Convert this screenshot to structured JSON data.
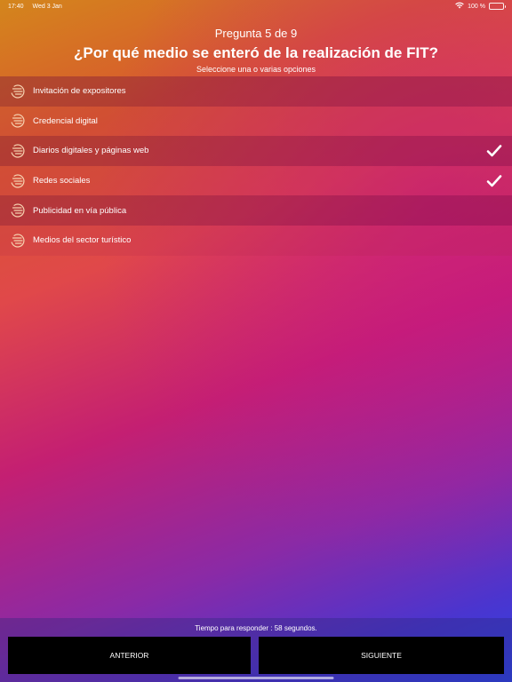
{
  "status_bar": {
    "time": "17:40",
    "date": "Wed 3 Jan",
    "battery": "100 %",
    "wifi_icon": "wifi-icon",
    "battery_icon": "battery-icon"
  },
  "question": {
    "counter": "Pregunta 5 de 9",
    "title": "¿Por qué medio se enteró de la realización de FIT?",
    "hint": "Seleccione una o varias opciones"
  },
  "options": [
    {
      "label": "Invitación de expositores",
      "selected": false,
      "icon": "list-icon"
    },
    {
      "label": "Credencial digital",
      "selected": false,
      "icon": "list-icon"
    },
    {
      "label": "Diarios digitales y páginas web",
      "selected": true,
      "icon": "list-icon"
    },
    {
      "label": "Redes sociales",
      "selected": true,
      "icon": "list-icon"
    },
    {
      "label": "Publicidad en vía pública",
      "selected": false,
      "icon": "list-icon"
    },
    {
      "label": "Medios del sector turístico",
      "selected": false,
      "icon": "list-icon"
    }
  ],
  "footer": {
    "timer_text": "Tiempo para responder : 58 segundos.",
    "prev_label": "ANTERIOR",
    "next_label": "SIGUIENTE"
  },
  "colors": {
    "button_bg": "#000000",
    "text": "#ffffff",
    "check": "#ffffff"
  }
}
